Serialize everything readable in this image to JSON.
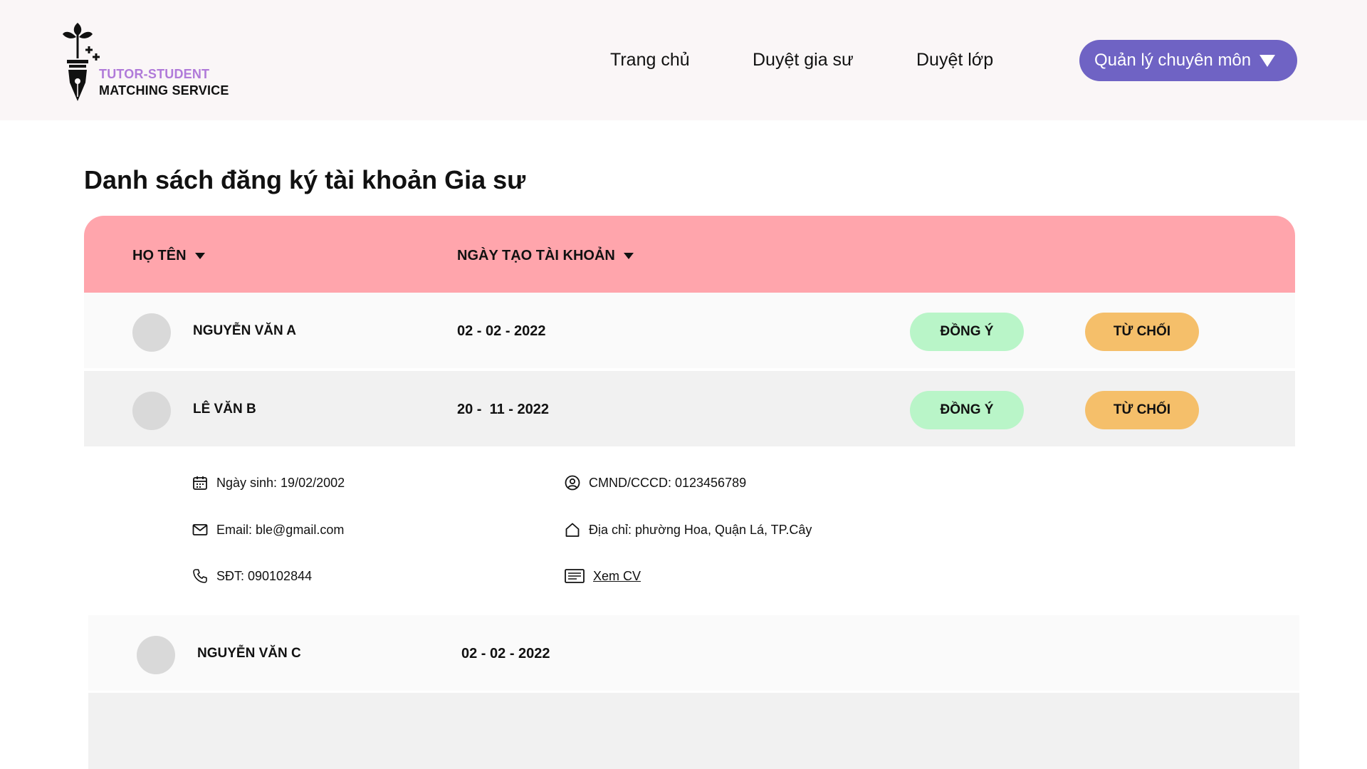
{
  "header": {
    "logo": {
      "line1": "TUTOR-STUDENT",
      "line2": "MATCHING SERVICE",
      "icon": "fountain-pen-sprout-icon"
    },
    "nav": {
      "home": "Trang chủ",
      "tutors": "Duyệt gia sư",
      "classes": "Duyệt lớp"
    },
    "dropdown": {
      "label": "Quản lý chuyên môn",
      "icon": "caret-down-icon"
    }
  },
  "page": {
    "title": "Danh sách đăng ký tài khoản Gia sư"
  },
  "table": {
    "columns": {
      "name": "HỌ TÊN",
      "created": "NGÀY TẠO TÀI KHOẢN"
    },
    "accept_label": "ĐỒNG Ý",
    "reject_label": "TỪ CHỐI",
    "rows": [
      {
        "name": "NGUYỄN VĂN A",
        "date": "02 - 02 - 2022"
      },
      {
        "name": "LÊ VĂN B",
        "date": "20 -  11 - 2022"
      },
      {
        "name": "NGUYỄN VĂN C",
        "date": "02 - 02 - 2022"
      }
    ],
    "expanded": {
      "dob": "Ngày sinh: 19/02/2002",
      "email": "Email: ble@gmail.com",
      "phone": "SĐT: 090102844",
      "id_card": "CMND/CCCD: 0123456789",
      "address": "Địa chỉ: phường Hoa, Quận Lá, TP.Cây",
      "cv": "Xem CV"
    }
  },
  "colors": {
    "header_bg": "#faf6f7",
    "accent_purple": "#6f63c4",
    "logo_purple": "#b07ad9",
    "table_head": "#ffa5ac",
    "accept": "#b9f5c8",
    "reject": "#f5bf6a"
  }
}
